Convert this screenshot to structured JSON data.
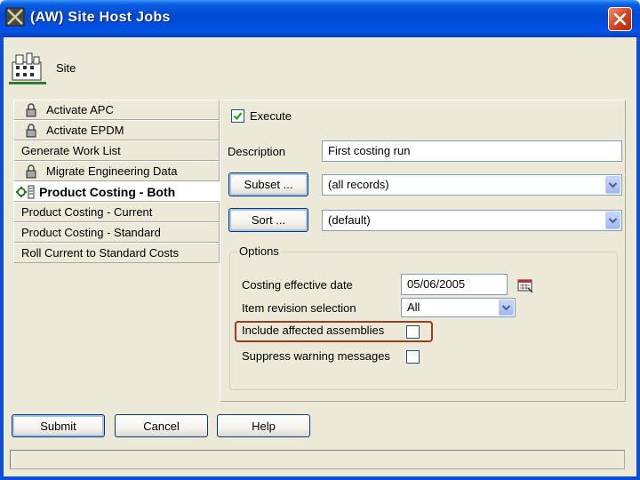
{
  "window": {
    "title": "(AW) Site Host Jobs",
    "close_icon": "close-icon"
  },
  "site": {
    "icon": "site-building-icon",
    "label": "Site"
  },
  "jobs": [
    {
      "label": "Activate APC",
      "icon": "lock-icon",
      "active": false
    },
    {
      "label": "Activate EPDM",
      "icon": "lock-icon",
      "active": false
    },
    {
      "label": "Generate Work List",
      "icon": "",
      "active": false
    },
    {
      "label": "Migrate Engineering Data",
      "icon": "lock-icon",
      "active": false
    },
    {
      "label": "Product Costing - Both",
      "icon": "gear-running-icon",
      "active": true
    },
    {
      "label": "Product Costing - Current",
      "icon": "",
      "active": false
    },
    {
      "label": "Product Costing - Standard",
      "icon": "",
      "active": false
    },
    {
      "label": "Roll Current to Standard Costs",
      "icon": "",
      "active": false
    }
  ],
  "form": {
    "execute_label": "Execute",
    "execute_checked": true,
    "description_label": "Description",
    "description_value": "First costing run",
    "subset_button": "Subset ...",
    "subset_value": "(all records)",
    "sort_button": "Sort ...",
    "sort_value": "(default)"
  },
  "options": {
    "legend": "Options",
    "costing_date_label": "Costing effective date",
    "costing_date_value": "05/06/2005",
    "calendar_icon": "calendar-icon",
    "item_revision_label": "Item revision selection",
    "item_revision_value": "All",
    "include_affected_label": "Include affected assemblies",
    "include_affected_checked": false,
    "suppress_warning_label": "Suppress warning messages",
    "suppress_warning_checked": false,
    "highlight_color": "#9c3c1a"
  },
  "buttons": {
    "submit": "Submit",
    "cancel": "Cancel",
    "help": "Help"
  },
  "colors": {
    "titlebar": "#0049d4",
    "window_bg": "#ece9d8",
    "close_button": "#d23c16"
  }
}
